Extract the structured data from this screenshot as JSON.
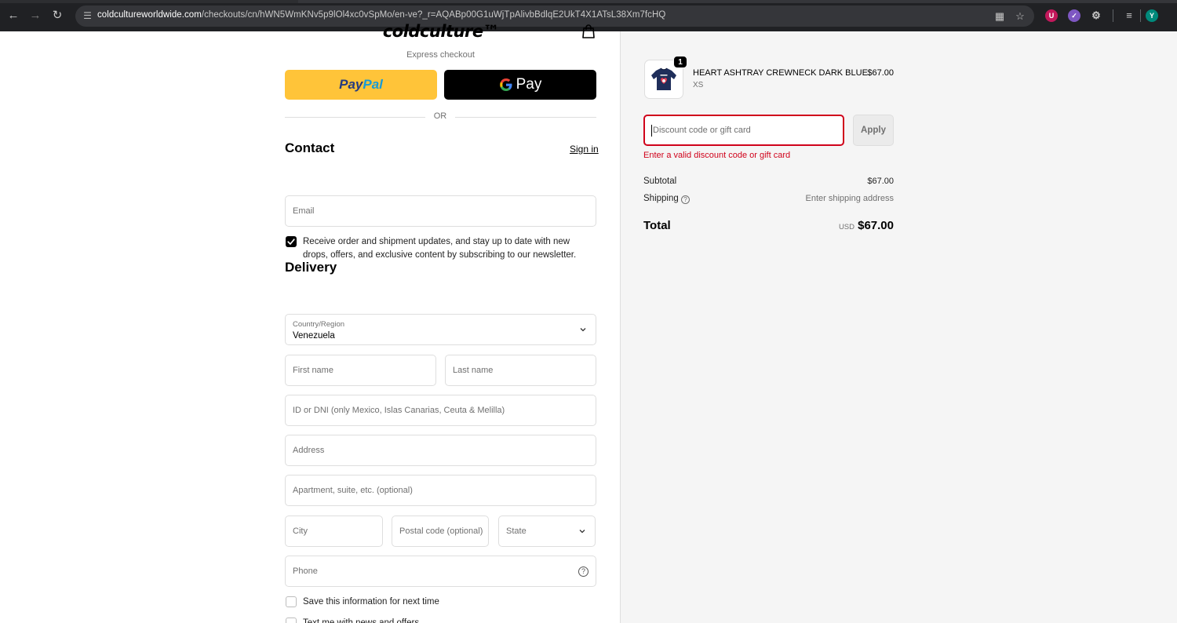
{
  "browser": {
    "url_host": "coldcultureworldwide.com",
    "url_path": "/checkouts/cn/hWN5WmKNv5p9lOl4xc0vSpMo/en-ve?_r=AQABp00G1uWjTpAlivbBdlqE2UkT4X1ATsL38Xm7fcHQ",
    "profile_initial": "Y",
    "extension_badge": "U"
  },
  "header": {
    "logo_text": "coldculture™",
    "express_label": "Express checkout",
    "or_label": "OR"
  },
  "express": {
    "paypal_pay": "Pay",
    "paypal_pal": "Pal",
    "gpay_label": "Pay"
  },
  "contact": {
    "title": "Contact",
    "sign_in": "Sign in",
    "email_placeholder": "Email",
    "newsletter_checked": true,
    "newsletter_text": "Receive order and shipment updates, and stay up to date with new drops, offers, and exclusive content by subscribing to our newsletter."
  },
  "delivery": {
    "title": "Delivery",
    "country_label": "Country/Region",
    "country_value": "Venezuela",
    "first_name": "First name",
    "last_name": "Last name",
    "id_dni": "ID or DNI (only Mexico, Islas Canarias, Ceuta & Melilla)",
    "address": "Address",
    "apartment": "Apartment, suite, etc. (optional)",
    "city": "City",
    "postal": "Postal code (optional)",
    "state": "State",
    "phone": "Phone",
    "save_info": "Save this information for next time",
    "text_offers": "Text me with news and offers"
  },
  "summary": {
    "product": {
      "quantity": "1",
      "name": "HEART ASHTRAY CREWNECK DARK BLUE",
      "variant": "XS",
      "price": "$67.00"
    },
    "discount_placeholder": "Discount code or gift card",
    "apply_label": "Apply",
    "discount_error": "Enter a valid discount code or gift card",
    "subtotal_label": "Subtotal",
    "subtotal_value": "$67.00",
    "shipping_label": "Shipping",
    "shipping_value": "Enter shipping address",
    "total_label": "Total",
    "total_currency": "USD",
    "total_value": "$67.00"
  },
  "colors": {
    "paypal_yellow": "#ffc439",
    "error_red": "#d0021b",
    "summary_bg": "#f5f5f5"
  }
}
